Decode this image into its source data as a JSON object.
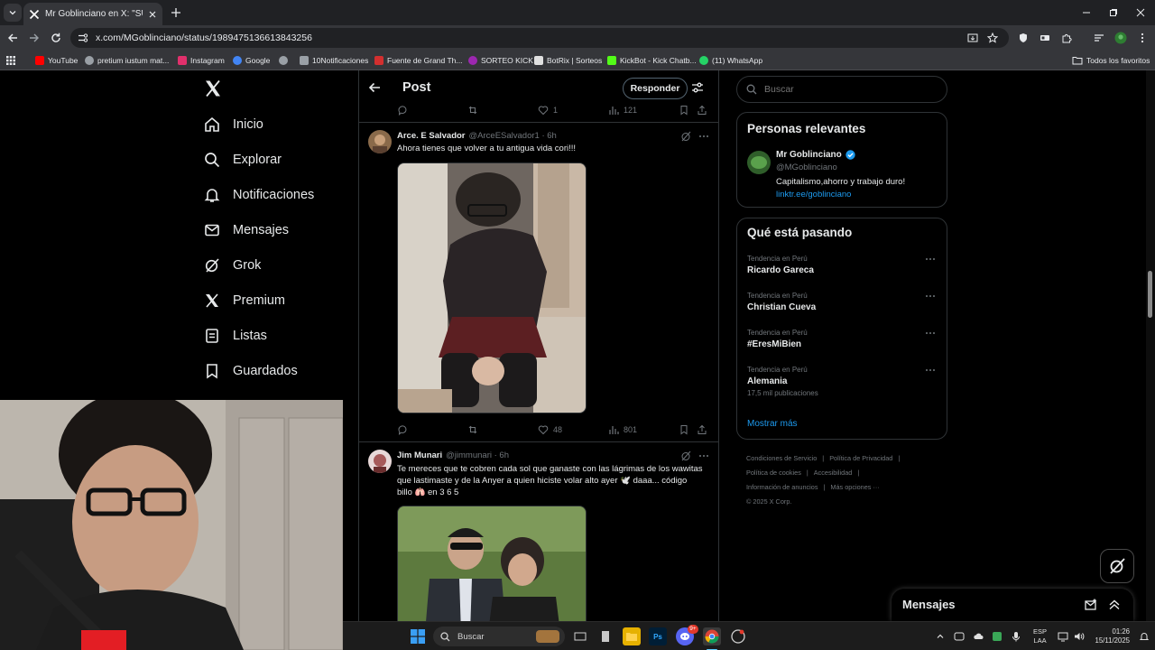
{
  "browser": {
    "tab_title": "Mr Goblinciano en X: \"SUNAT l",
    "url": "x.com/MGoblinciano/status/1989475136613843256",
    "bookmarks": [
      {
        "label": "YouTube",
        "color": "#ff0000"
      },
      {
        "label": "pretium iustum mat...",
        "color": "#9aa0a6"
      },
      {
        "label": "Instagram",
        "color": "#e1306c"
      },
      {
        "label": "Google",
        "color": "#4285f4"
      },
      {
        "label": "",
        "color": "#9aa0a6"
      },
      {
        "label": "10Notificaciones",
        "color": "#9aa0a6"
      },
      {
        "label": "Fuente de Grand Th...",
        "color": "#d32f2f"
      },
      {
        "label": "SORTEO KICK",
        "color": "#9c27b0"
      },
      {
        "label": "BotRix | Sorteos",
        "color": "#e0e0e0"
      },
      {
        "label": "KickBot - Kick Chatb...",
        "color": "#53fc18"
      },
      {
        "label": "(11) WhatsApp",
        "color": "#25d366"
      }
    ],
    "all_favorites": "Todos los favoritos"
  },
  "sidebar": {
    "items": [
      {
        "label": "Inicio",
        "icon": "home-icon"
      },
      {
        "label": "Explorar",
        "icon": "search-icon"
      },
      {
        "label": "Notificaciones",
        "icon": "bell-icon"
      },
      {
        "label": "Mensajes",
        "icon": "envelope-icon"
      },
      {
        "label": "Grok",
        "icon": "grok-icon"
      },
      {
        "label": "Premium",
        "icon": "x-icon"
      },
      {
        "label": "Listas",
        "icon": "list-icon"
      },
      {
        "label": "Guardados",
        "icon": "bookmark-icon"
      }
    ]
  },
  "post_header": {
    "title": "Post",
    "reply_label": "Responder"
  },
  "top_actions": {
    "likes": "1",
    "views": "121"
  },
  "tweets": [
    {
      "name": "Arce. E Salvador",
      "handle": "@ArceESalvador1 · 6h",
      "text": "Ahora tienes que volver a tu antigua vida cori!!!",
      "likes": "48",
      "views": "801"
    },
    {
      "name": "Jim Munari",
      "handle": "@jimmunari · 6h",
      "text": "Te mereces que te cobren cada sol que ganaste con las lágrimas de los wawitas que lastimaste y de la Anyer a quien hiciste volar alto ayer 🕊️ daaa... código billo 🫁 en 3 6 5"
    }
  ],
  "search": {
    "placeholder": "Buscar"
  },
  "relevant": {
    "title": "Personas relevantes",
    "name": "Mr Goblinciano",
    "handle": "@MGoblinciano",
    "bio": "Capitalismo,ahorro y trabajo duro!",
    "link": "linktr.ee/goblinciano"
  },
  "trending": {
    "title": "Qué está pasando",
    "items": [
      {
        "category": "Tendencia en Perú",
        "name": "Ricardo Gareca",
        "extra": ""
      },
      {
        "category": "Tendencia en Perú",
        "name": "Christian Cueva",
        "extra": ""
      },
      {
        "category": "Tendencia en Perú",
        "name": "#EresMiBien",
        "extra": ""
      },
      {
        "category": "Tendencia en Perú",
        "name": "Alemania",
        "extra": "17,5 mil publicaciones"
      }
    ],
    "show_more": "Mostrar más"
  },
  "footer": {
    "terms": "Condiciones de Servicio",
    "privacy": "Política de Privacidad",
    "cookies": "Política de cookies",
    "accessibility": "Accesibilidad",
    "ads": "Información de anuncios",
    "more": "Más opciones ···",
    "copyright": "© 2025 X Corp."
  },
  "messages_drawer": {
    "title": "Mensajes"
  },
  "taskbar": {
    "search": "Buscar",
    "lang_top": "ESP",
    "lang_bottom": "LAA",
    "time": "01:26",
    "date": "15/11/2025",
    "badge": "9+"
  },
  "colors": {
    "accent": "#1d9bf0",
    "border": "#2f3336",
    "muted": "#71767b"
  }
}
